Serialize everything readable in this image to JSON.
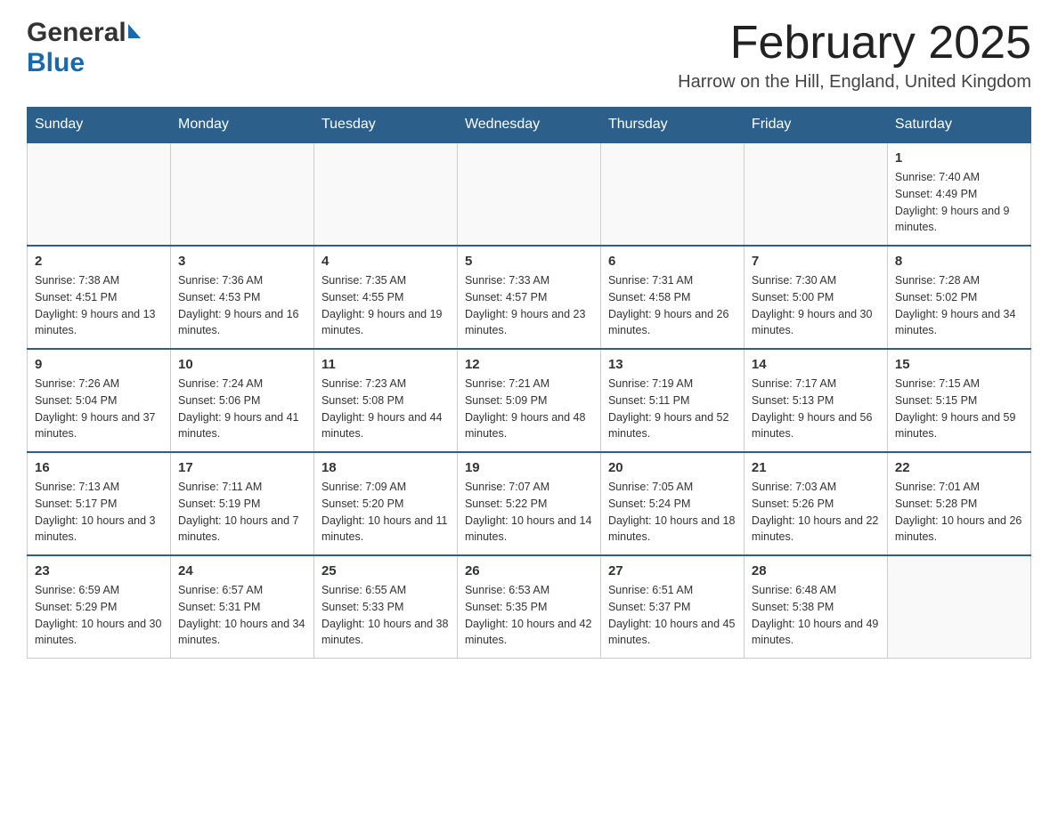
{
  "header": {
    "logo_general": "General",
    "logo_blue": "Blue",
    "month_title": "February 2025",
    "location": "Harrow on the Hill, England, United Kingdom"
  },
  "weekdays": [
    "Sunday",
    "Monday",
    "Tuesday",
    "Wednesday",
    "Thursday",
    "Friday",
    "Saturday"
  ],
  "weeks": [
    [
      {
        "day": "",
        "info": ""
      },
      {
        "day": "",
        "info": ""
      },
      {
        "day": "",
        "info": ""
      },
      {
        "day": "",
        "info": ""
      },
      {
        "day": "",
        "info": ""
      },
      {
        "day": "",
        "info": ""
      },
      {
        "day": "1",
        "info": "Sunrise: 7:40 AM\nSunset: 4:49 PM\nDaylight: 9 hours and 9 minutes."
      }
    ],
    [
      {
        "day": "2",
        "info": "Sunrise: 7:38 AM\nSunset: 4:51 PM\nDaylight: 9 hours and 13 minutes."
      },
      {
        "day": "3",
        "info": "Sunrise: 7:36 AM\nSunset: 4:53 PM\nDaylight: 9 hours and 16 minutes."
      },
      {
        "day": "4",
        "info": "Sunrise: 7:35 AM\nSunset: 4:55 PM\nDaylight: 9 hours and 19 minutes."
      },
      {
        "day": "5",
        "info": "Sunrise: 7:33 AM\nSunset: 4:57 PM\nDaylight: 9 hours and 23 minutes."
      },
      {
        "day": "6",
        "info": "Sunrise: 7:31 AM\nSunset: 4:58 PM\nDaylight: 9 hours and 26 minutes."
      },
      {
        "day": "7",
        "info": "Sunrise: 7:30 AM\nSunset: 5:00 PM\nDaylight: 9 hours and 30 minutes."
      },
      {
        "day": "8",
        "info": "Sunrise: 7:28 AM\nSunset: 5:02 PM\nDaylight: 9 hours and 34 minutes."
      }
    ],
    [
      {
        "day": "9",
        "info": "Sunrise: 7:26 AM\nSunset: 5:04 PM\nDaylight: 9 hours and 37 minutes."
      },
      {
        "day": "10",
        "info": "Sunrise: 7:24 AM\nSunset: 5:06 PM\nDaylight: 9 hours and 41 minutes."
      },
      {
        "day": "11",
        "info": "Sunrise: 7:23 AM\nSunset: 5:08 PM\nDaylight: 9 hours and 44 minutes."
      },
      {
        "day": "12",
        "info": "Sunrise: 7:21 AM\nSunset: 5:09 PM\nDaylight: 9 hours and 48 minutes."
      },
      {
        "day": "13",
        "info": "Sunrise: 7:19 AM\nSunset: 5:11 PM\nDaylight: 9 hours and 52 minutes."
      },
      {
        "day": "14",
        "info": "Sunrise: 7:17 AM\nSunset: 5:13 PM\nDaylight: 9 hours and 56 minutes."
      },
      {
        "day": "15",
        "info": "Sunrise: 7:15 AM\nSunset: 5:15 PM\nDaylight: 9 hours and 59 minutes."
      }
    ],
    [
      {
        "day": "16",
        "info": "Sunrise: 7:13 AM\nSunset: 5:17 PM\nDaylight: 10 hours and 3 minutes."
      },
      {
        "day": "17",
        "info": "Sunrise: 7:11 AM\nSunset: 5:19 PM\nDaylight: 10 hours and 7 minutes."
      },
      {
        "day": "18",
        "info": "Sunrise: 7:09 AM\nSunset: 5:20 PM\nDaylight: 10 hours and 11 minutes."
      },
      {
        "day": "19",
        "info": "Sunrise: 7:07 AM\nSunset: 5:22 PM\nDaylight: 10 hours and 14 minutes."
      },
      {
        "day": "20",
        "info": "Sunrise: 7:05 AM\nSunset: 5:24 PM\nDaylight: 10 hours and 18 minutes."
      },
      {
        "day": "21",
        "info": "Sunrise: 7:03 AM\nSunset: 5:26 PM\nDaylight: 10 hours and 22 minutes."
      },
      {
        "day": "22",
        "info": "Sunrise: 7:01 AM\nSunset: 5:28 PM\nDaylight: 10 hours and 26 minutes."
      }
    ],
    [
      {
        "day": "23",
        "info": "Sunrise: 6:59 AM\nSunset: 5:29 PM\nDaylight: 10 hours and 30 minutes."
      },
      {
        "day": "24",
        "info": "Sunrise: 6:57 AM\nSunset: 5:31 PM\nDaylight: 10 hours and 34 minutes."
      },
      {
        "day": "25",
        "info": "Sunrise: 6:55 AM\nSunset: 5:33 PM\nDaylight: 10 hours and 38 minutes."
      },
      {
        "day": "26",
        "info": "Sunrise: 6:53 AM\nSunset: 5:35 PM\nDaylight: 10 hours and 42 minutes."
      },
      {
        "day": "27",
        "info": "Sunrise: 6:51 AM\nSunset: 5:37 PM\nDaylight: 10 hours and 45 minutes."
      },
      {
        "day": "28",
        "info": "Sunrise: 6:48 AM\nSunset: 5:38 PM\nDaylight: 10 hours and 49 minutes."
      },
      {
        "day": "",
        "info": ""
      }
    ]
  ]
}
